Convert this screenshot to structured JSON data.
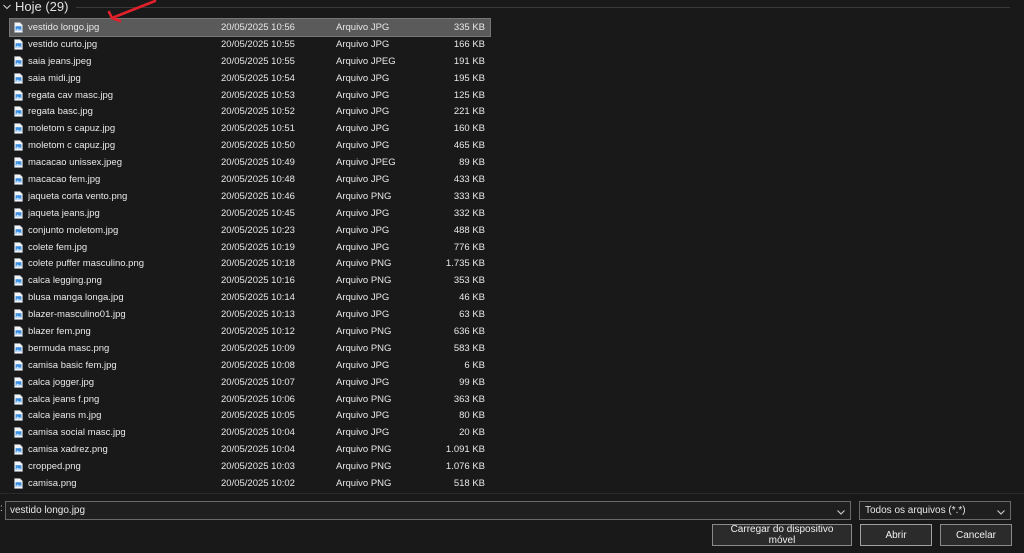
{
  "group": {
    "title": "Hoje (29)"
  },
  "files": [
    {
      "name": "vestido longo.jpg",
      "date": "20/05/2025 10:56",
      "type": "Arquivo JPG",
      "size": "335 KB",
      "selected": true
    },
    {
      "name": "vestido curto.jpg",
      "date": "20/05/2025 10:55",
      "type": "Arquivo JPG",
      "size": "166 KB"
    },
    {
      "name": "saia jeans.jpeg",
      "date": "20/05/2025 10:55",
      "type": "Arquivo JPEG",
      "size": "191 KB"
    },
    {
      "name": "saia midi.jpg",
      "date": "20/05/2025 10:54",
      "type": "Arquivo JPG",
      "size": "195 KB"
    },
    {
      "name": "regata cav masc.jpg",
      "date": "20/05/2025 10:53",
      "type": "Arquivo JPG",
      "size": "125 KB"
    },
    {
      "name": "regata basc.jpg",
      "date": "20/05/2025 10:52",
      "type": "Arquivo JPG",
      "size": "221 KB"
    },
    {
      "name": "moletom s capuz.jpg",
      "date": "20/05/2025 10:51",
      "type": "Arquivo JPG",
      "size": "160 KB"
    },
    {
      "name": "moletom c capuz.jpg",
      "date": "20/05/2025 10:50",
      "type": "Arquivo JPG",
      "size": "465 KB"
    },
    {
      "name": "macacao unissex.jpeg",
      "date": "20/05/2025 10:49",
      "type": "Arquivo JPEG",
      "size": "89 KB"
    },
    {
      "name": "macacao fem.jpg",
      "date": "20/05/2025 10:48",
      "type": "Arquivo JPG",
      "size": "433 KB"
    },
    {
      "name": "jaqueta corta vento.png",
      "date": "20/05/2025 10:46",
      "type": "Arquivo PNG",
      "size": "333 KB"
    },
    {
      "name": "jaqueta jeans.jpg",
      "date": "20/05/2025 10:45",
      "type": "Arquivo JPG",
      "size": "332 KB"
    },
    {
      "name": "conjunto moletom.jpg",
      "date": "20/05/2025 10:23",
      "type": "Arquivo JPG",
      "size": "488 KB"
    },
    {
      "name": "colete fem.jpg",
      "date": "20/05/2025 10:19",
      "type": "Arquivo JPG",
      "size": "776 KB"
    },
    {
      "name": "colete puffer masculino.png",
      "date": "20/05/2025 10:18",
      "type": "Arquivo PNG",
      "size": "1.735 KB"
    },
    {
      "name": "calca legging.png",
      "date": "20/05/2025 10:16",
      "type": "Arquivo PNG",
      "size": "353 KB"
    },
    {
      "name": "blusa manga longa.jpg",
      "date": "20/05/2025 10:14",
      "type": "Arquivo JPG",
      "size": "46 KB"
    },
    {
      "name": "blazer-masculino01.jpg",
      "date": "20/05/2025 10:13",
      "type": "Arquivo JPG",
      "size": "63 KB"
    },
    {
      "name": "blazer fem.png",
      "date": "20/05/2025 10:12",
      "type": "Arquivo PNG",
      "size": "636 KB"
    },
    {
      "name": "bermuda masc.png",
      "date": "20/05/2025 10:09",
      "type": "Arquivo PNG",
      "size": "583 KB"
    },
    {
      "name": "camisa basic fem.jpg",
      "date": "20/05/2025 10:08",
      "type": "Arquivo JPG",
      "size": "6 KB"
    },
    {
      "name": "calca jogger.jpg",
      "date": "20/05/2025 10:07",
      "type": "Arquivo JPG",
      "size": "99 KB"
    },
    {
      "name": "calca jeans f.png",
      "date": "20/05/2025 10:06",
      "type": "Arquivo PNG",
      "size": "363 KB"
    },
    {
      "name": "calca jeans m.jpg",
      "date": "20/05/2025 10:05",
      "type": "Arquivo JPG",
      "size": "80 KB"
    },
    {
      "name": "camisa social masc.jpg",
      "date": "20/05/2025 10:04",
      "type": "Arquivo JPG",
      "size": "20 KB"
    },
    {
      "name": "camisa xadrez.png",
      "date": "20/05/2025 10:04",
      "type": "Arquivo PNG",
      "size": "1.091 KB"
    },
    {
      "name": "cropped.png",
      "date": "20/05/2025 10:03",
      "type": "Arquivo PNG",
      "size": "1.076 KB"
    },
    {
      "name": "camisa.png",
      "date": "20/05/2025 10:02",
      "type": "Arquivo PNG",
      "size": "518 KB"
    }
  ],
  "bottom": {
    "label_edge": ":",
    "filename_value": "vestido longo.jpg",
    "filetype_value": "Todos os arquivos (*.*)",
    "mobile_button": "Carregar do dispositivo móvel",
    "open_button": "Abrir",
    "cancel_button": "Cancelar"
  },
  "colors": {
    "background": "#191919",
    "selected_row": "#5a5a5a",
    "annotation": "#e0202a",
    "file_icon": "#3b8ee0"
  },
  "icons": {
    "file": "image-file-icon",
    "chevron": "chevron-down-icon",
    "arrow": "red-arrow-annotation"
  }
}
